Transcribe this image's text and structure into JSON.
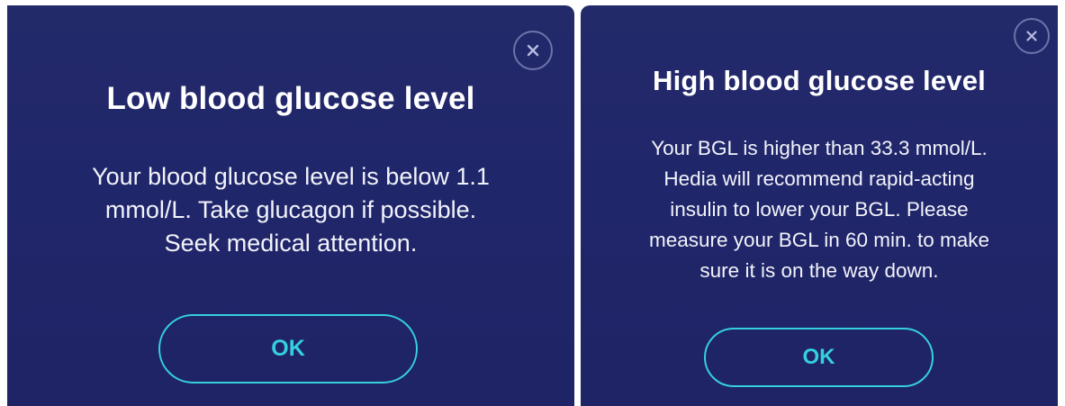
{
  "dialogs": [
    {
      "title": "Low blood glucose level",
      "lines": [
        "Your blood glucose level is below 1.1",
        "mmol/L. Take glucagon if possible.",
        "Seek medical attention."
      ],
      "ok_label": "OK"
    },
    {
      "title": "High blood glucose level",
      "lines": [
        "Your BGL is higher than 33.3 mmol/L.",
        "Hedia will recommend rapid-acting",
        "insulin to lower your BGL. Please",
        "measure your BGL in 60 min. to make",
        "sure it is on the way down."
      ],
      "ok_label": "OK"
    }
  ],
  "icons": {
    "close": "close-icon"
  },
  "colors": {
    "panel_bg": "#20266a",
    "accent": "#35d0dc",
    "text": "#ffffff"
  }
}
